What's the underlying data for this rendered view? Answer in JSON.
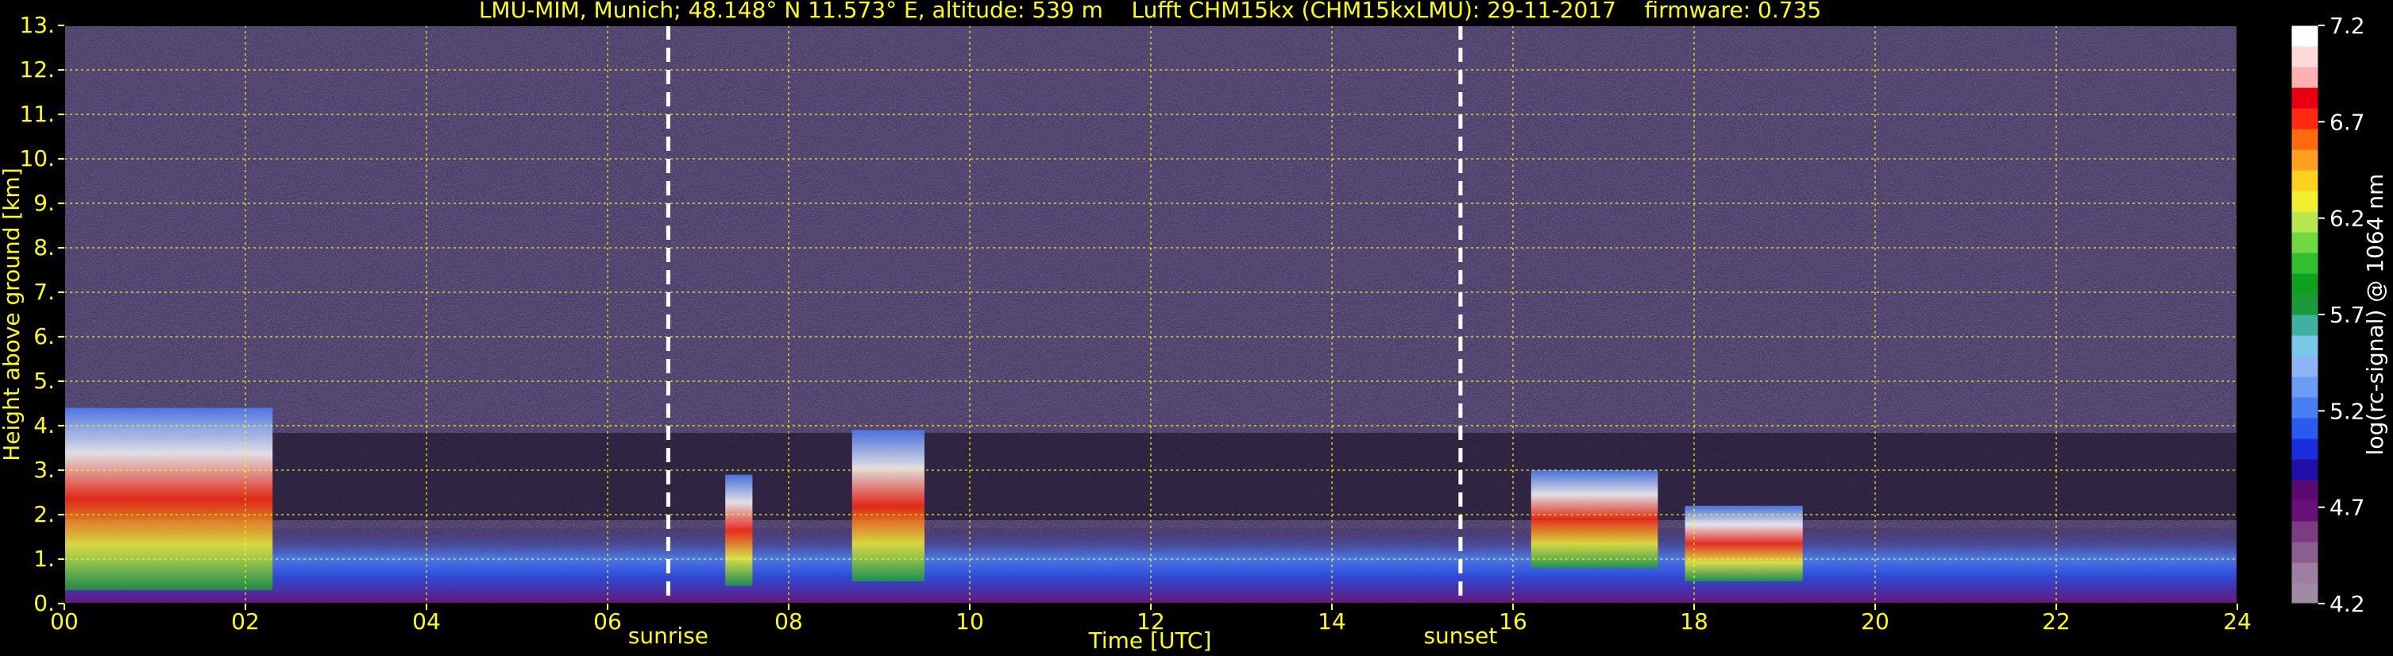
{
  "header": {
    "title": "LMU-MIM, Munich; 48.148° N 11.573° E, altitude: 539 m    Lufft CHM15kx (CHM15kxLMU): 29-11-2017    firmware: 0.735"
  },
  "chart_data": {
    "type": "heatmap",
    "title": "LMU-MIM, Munich; 48.148° N 11.573° E, altitude: 539 m    Lufft CHM15kx (CHM15kxLMU): 29-11-2017    firmware: 0.735",
    "xlabel": "Time [UTC]",
    "ylabel": "Height above ground [km]",
    "xlim": [
      0,
      24
    ],
    "ylim": [
      0,
      13
    ],
    "x_ticks": [
      0,
      2,
      4,
      6,
      8,
      10,
      12,
      14,
      16,
      18,
      20,
      22,
      24
    ],
    "x_tick_labels": [
      "00",
      "02",
      "04",
      "06",
      "08",
      "10",
      "12",
      "14",
      "16",
      "18",
      "20",
      "22",
      "24"
    ],
    "y_ticks": [
      0,
      1,
      2,
      3,
      4,
      5,
      6,
      7,
      8,
      9,
      10,
      11,
      12,
      13
    ],
    "y_tick_labels": [
      "0.",
      "1.",
      "2.",
      "3.",
      "4.",
      "5.",
      "6.",
      "7.",
      "8.",
      "9.",
      "10.",
      "11.",
      "12.",
      "13."
    ],
    "grid": true,
    "markers": [
      {
        "label": "sunrise",
        "x": 6.67
      },
      {
        "label": "sunset",
        "x": 15.42
      }
    ],
    "colorbar": {
      "label": "log(rc-signal) @ 1064 nm",
      "range": [
        4.2,
        7.2
      ],
      "tick_values": [
        7.2,
        6.7,
        6.2,
        5.7,
        5.2,
        4.7,
        4.2
      ],
      "tick_labels": [
        "7.2",
        "6.7",
        "6.2",
        "5.7",
        "5.2",
        "4.7",
        "4.2"
      ],
      "colors": [
        "#a08aa4",
        "#9e7fa1",
        "#8a5f8f",
        "#7a3d82",
        "#6a0f78",
        "#5a0a70",
        "#1e0fa8",
        "#1a2ee0",
        "#2a5af0",
        "#4a7ef4",
        "#6c9cf5",
        "#8cb4f7",
        "#7ac8e8",
        "#40b0a0",
        "#1a9a3a",
        "#10a020",
        "#30c030",
        "#70d840",
        "#b8e850",
        "#f0f030",
        "#ffd020",
        "#ffa020",
        "#ff6a10",
        "#ff2a10",
        "#e80010",
        "#ffb0b0",
        "#ffd8d8",
        "#ffffff"
      ]
    },
    "features": [
      {
        "name": "boundary layer",
        "x_range": [
          0,
          24
        ],
        "height_km": [
          0.0,
          1.7
        ]
      },
      {
        "name": "low clouds",
        "x_range": [
          0,
          2.3
        ],
        "height_km": [
          0.3,
          4.4
        ]
      },
      {
        "name": "cloud",
        "x_range": [
          7.3,
          7.6
        ],
        "height_km": [
          0.4,
          2.9
        ]
      },
      {
        "name": "cloud",
        "x_range": [
          8.7,
          9.5
        ],
        "height_km": [
          0.5,
          3.9
        ]
      },
      {
        "name": "cloud",
        "x_range": [
          16.2,
          17.6
        ],
        "height_km": [
          0.8,
          3.0
        ]
      },
      {
        "name": "cloud",
        "x_range": [
          17.9,
          19.2
        ],
        "height_km": [
          0.5,
          2.2
        ]
      }
    ]
  }
}
